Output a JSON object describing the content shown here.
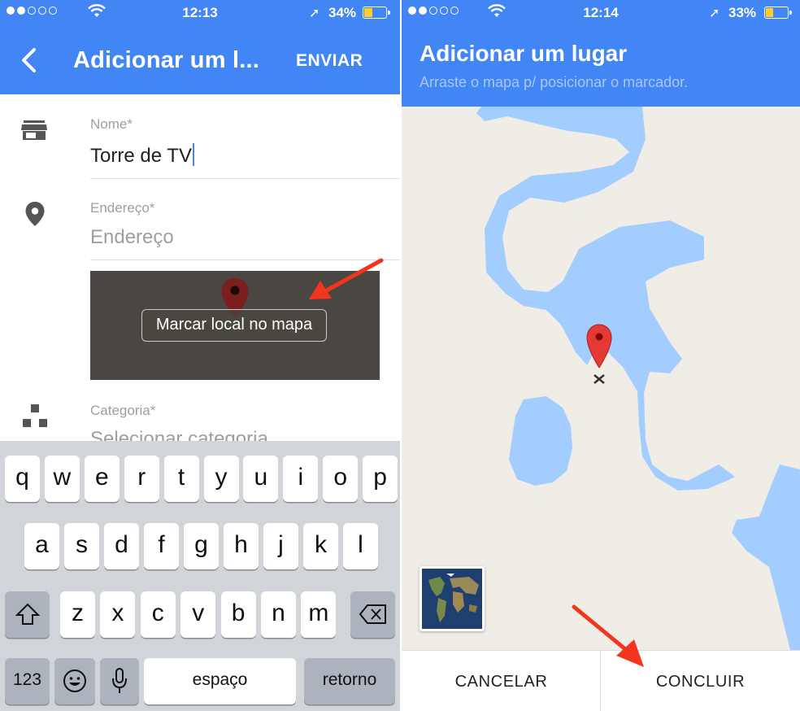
{
  "left": {
    "status": {
      "time": "12:13",
      "battery": "34%"
    },
    "appbar": {
      "title": "Adicionar um l...",
      "send_label": "ENVIAR"
    },
    "name_field": {
      "label": "Nome*",
      "value": "Torre de TV"
    },
    "address_field": {
      "label": "Endereço*",
      "placeholder": "Endereço"
    },
    "map_button": "Marcar local no mapa",
    "category_field": {
      "label": "Categoria*",
      "placeholder": "Selecionar categoria"
    },
    "keyboard": {
      "row1": [
        "q",
        "w",
        "e",
        "r",
        "t",
        "y",
        "u",
        "i",
        "o",
        "p"
      ],
      "row2": [
        "a",
        "s",
        "d",
        "f",
        "g",
        "h",
        "j",
        "k",
        "l"
      ],
      "row3": [
        "z",
        "x",
        "c",
        "v",
        "b",
        "n",
        "m"
      ],
      "numbers_label": "123",
      "space_label": "espaço",
      "return_label": "retorno"
    }
  },
  "right": {
    "status": {
      "time": "12:14",
      "battery": "33%"
    },
    "appbar": {
      "title": "Adicionar um lugar",
      "subtitle": "Arraste o mapa p/ posicionar o marcador."
    },
    "buttons": {
      "cancel": "CANCELAR",
      "done": "CONCLUIR"
    }
  },
  "colors": {
    "accent": "#4285f4",
    "water": "#a3ccff",
    "land": "#f0ede6",
    "pin": "#e53935",
    "annotation_arrow": "#f2361e"
  }
}
